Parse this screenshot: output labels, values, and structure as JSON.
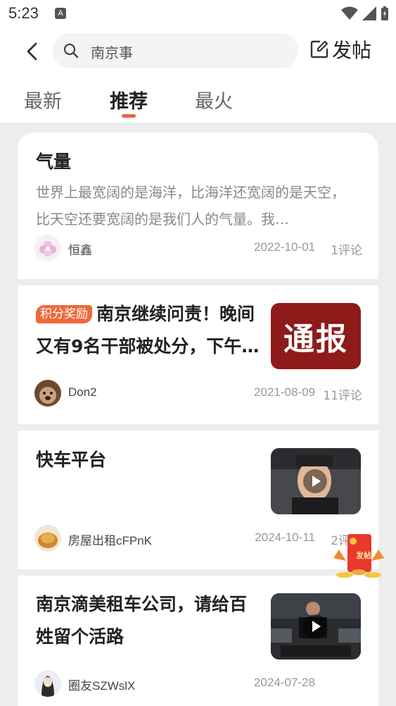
{
  "status_bar": {
    "time": "5:23",
    "notif_glyph": "A"
  },
  "search": {
    "query": "南京事"
  },
  "header": {
    "post_label": "发帖"
  },
  "tabs": [
    {
      "label": "最新"
    },
    {
      "label": "推荐"
    },
    {
      "label": "最火"
    }
  ],
  "posts": [
    {
      "title": "气量",
      "excerpt": "世界上最宽阔的是海洋，比海洋还宽阔的是天空，比天空还要宽阔的是我们人的气量。我…",
      "author": "恒鑫",
      "date": "2022-10-01",
      "comments": "1评论"
    },
    {
      "badge": "积分奖励",
      "title": "南京继续问责！晚间又有9名干部被处分，下午…",
      "thumb_text": "通报",
      "author": "Don2",
      "date": "2021-08-09",
      "comments": "11评论"
    },
    {
      "title": "快车平台",
      "author": "房屋出租cFPnK",
      "date": "2024-10-11",
      "comments": "2评论"
    },
    {
      "title": "南京滴美租车公司，请给百姓留个活路",
      "author": "圈友SZWslX",
      "date": "2024-07-28"
    }
  ],
  "float_button": {
    "label": "发帖"
  },
  "colors": {
    "accent": "#e8643a",
    "badge": "#ee6a3a",
    "notice_red": "#8e1a1a"
  }
}
